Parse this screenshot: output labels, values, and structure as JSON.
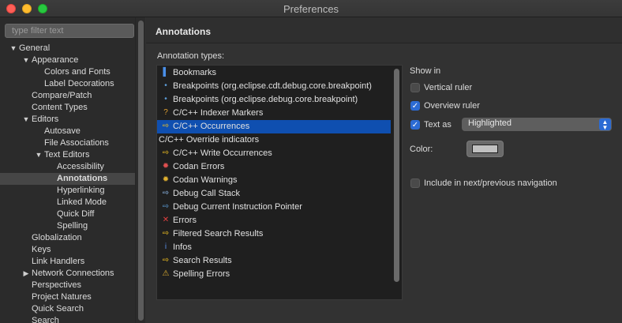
{
  "window": {
    "title": "Preferences"
  },
  "left": {
    "filter_placeholder": "type filter text",
    "tree": [
      {
        "label": "General",
        "arrow": "▼"
      },
      {
        "label": "Appearance",
        "arrow": "▼"
      },
      {
        "label": "Colors and Fonts"
      },
      {
        "label": "Label Decorations"
      },
      {
        "label": "Compare/Patch"
      },
      {
        "label": "Content Types"
      },
      {
        "label": "Editors",
        "arrow": "▼"
      },
      {
        "label": "Autosave"
      },
      {
        "label": "File Associations"
      },
      {
        "label": "Text Editors",
        "arrow": "▼"
      },
      {
        "label": "Accessibility"
      },
      {
        "label": "Annotations",
        "selected": true
      },
      {
        "label": "Hyperlinking"
      },
      {
        "label": "Linked Mode"
      },
      {
        "label": "Quick Diff"
      },
      {
        "label": "Spelling"
      },
      {
        "label": "Globalization"
      },
      {
        "label": "Keys"
      },
      {
        "label": "Link Handlers"
      },
      {
        "label": "Network Connections",
        "arrow": "▶"
      },
      {
        "label": "Perspectives"
      },
      {
        "label": "Project Natures"
      },
      {
        "label": "Quick Search"
      },
      {
        "label": "Search"
      }
    ]
  },
  "main": {
    "title": "Annotations",
    "types_label": "Annotation types:",
    "annotation_types": [
      {
        "label": "Bookmarks",
        "icon": "bookmark-icon",
        "glyph": "▌",
        "color": "#4a8fe8"
      },
      {
        "label": "Breakpoints (org.eclipse.cdt.debug.core.breakpoint)",
        "icon": "breakpoint-icon",
        "glyph": "•",
        "color": "#5b9bd5"
      },
      {
        "label": "Breakpoints (org.eclipse.debug.core.breakpoint)",
        "icon": "breakpoint-icon",
        "glyph": "•",
        "color": "#5b9bd5"
      },
      {
        "label": "C/C++ Indexer Markers",
        "icon": "indexer-marker-icon",
        "glyph": "?",
        "color": "#e0a030"
      },
      {
        "label": "C/C++ Occurrences",
        "icon": "occurrences-icon",
        "glyph": "⇨",
        "color": "#f0c020",
        "selected": true
      },
      {
        "label": "C/C++ Override indicators",
        "icon": "",
        "glyph": "",
        "color": ""
      },
      {
        "label": "C/C++ Write Occurrences",
        "icon": "write-occurrences-icon",
        "glyph": "⇨",
        "color": "#f0c020"
      },
      {
        "label": "Codan Errors",
        "icon": "codan-error-icon",
        "glyph": "✹",
        "color": "#e05050"
      },
      {
        "label": "Codan Warnings",
        "icon": "codan-warning-icon",
        "glyph": "✹",
        "color": "#e0b030"
      },
      {
        "label": "Debug Call Stack",
        "icon": "call-stack-icon",
        "glyph": "⇨",
        "color": "#8fb8e8"
      },
      {
        "label": "Debug Current Instruction Pointer",
        "icon": "instruction-pointer-icon",
        "glyph": "⇨",
        "color": "#5b9bd5"
      },
      {
        "label": "Errors",
        "icon": "error-icon",
        "glyph": "✕",
        "color": "#e04040"
      },
      {
        "label": "Filtered Search Results",
        "icon": "filtered-search-icon",
        "glyph": "⇨",
        "color": "#f0c020"
      },
      {
        "label": "Infos",
        "icon": "info-icon",
        "glyph": "i",
        "color": "#5b8fe8"
      },
      {
        "label": "Search Results",
        "icon": "search-results-icon",
        "glyph": "⇨",
        "color": "#f0c020"
      },
      {
        "label": "Spelling Errors",
        "icon": "spelling-warning-icon",
        "glyph": "⚠",
        "color": "#e0b030"
      }
    ],
    "options": {
      "show_in_label": "Show in",
      "vertical_ruler": {
        "label": "Vertical ruler",
        "checked": false
      },
      "overview_ruler": {
        "label": "Overview ruler",
        "checked": true
      },
      "text_as": {
        "label": "Text as",
        "checked": true,
        "value": "Highlighted"
      },
      "color_label": "Color:",
      "color_value": "#c0c0c0",
      "include_navigation": {
        "label": "Include in next/previous navigation",
        "checked": false
      }
    }
  }
}
